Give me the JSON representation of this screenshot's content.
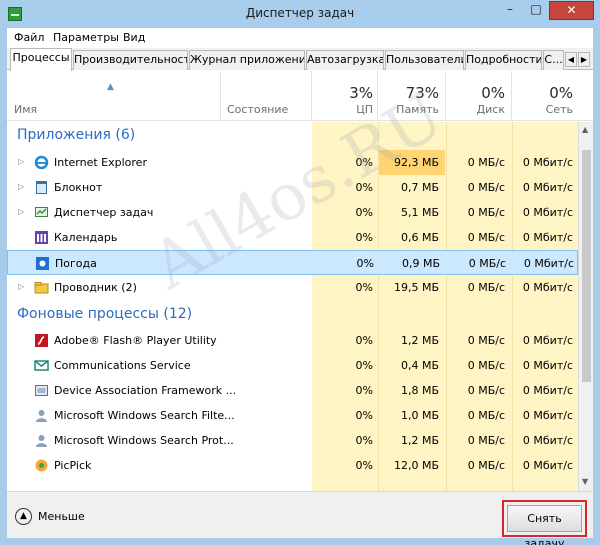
{
  "window": {
    "title": "Диспетчер задач",
    "minimize_glyph": "–",
    "maximize_glyph": "□",
    "close_glyph": "✕"
  },
  "menu": [
    "Файл",
    "Параметры",
    "Вид"
  ],
  "tabs": [
    "Процессы",
    "Производительность",
    "Журнал приложений",
    "Автозагрузка",
    "Пользователи",
    "Подробности",
    "С..."
  ],
  "columns": {
    "name": "Имя",
    "status": "Состояние",
    "cpu": {
      "percent": "3%",
      "label": "ЦП"
    },
    "memory": {
      "percent": "73%",
      "label": "Память"
    },
    "disk": {
      "percent": "0%",
      "label": "Диск"
    },
    "network": {
      "percent": "0%",
      "label": "Сеть"
    }
  },
  "groups": {
    "apps": {
      "title": "Приложения (6)",
      "rows": [
        {
          "name": "Internet Explorer",
          "icon": "ie-icon",
          "cpu": "0%",
          "mem": "92,3 МБ",
          "disk": "0 МБ/с",
          "net": "0 Мбит/с"
        },
        {
          "name": "Блокнот",
          "icon": "notepad-icon",
          "cpu": "0%",
          "mem": "0,7 МБ",
          "disk": "0 МБ/с",
          "net": "0 Мбит/с"
        },
        {
          "name": "Диспетчер задач",
          "icon": "task-manager-icon",
          "cpu": "0%",
          "mem": "5,1 МБ",
          "disk": "0 МБ/с",
          "net": "0 Мбит/с"
        },
        {
          "name": "Календарь",
          "icon": "calendar-icon",
          "cpu": "0%",
          "mem": "0,6 МБ",
          "disk": "0 МБ/с",
          "net": "0 Мбит/с"
        },
        {
          "name": "Погода",
          "icon": "weather-icon",
          "cpu": "0%",
          "mem": "0,9 МБ",
          "disk": "0 МБ/с",
          "net": "0 Мбит/с"
        },
        {
          "name": "Проводник (2)",
          "icon": "explorer-icon",
          "cpu": "0%",
          "mem": "19,5 МБ",
          "disk": "0 МБ/с",
          "net": "0 Мбит/с"
        }
      ]
    },
    "background": {
      "title": "Фоновые процессы (12)",
      "rows": [
        {
          "name": "Adobe® Flash® Player Utility",
          "icon": "flash-icon",
          "cpu": "0%",
          "mem": "1,2 МБ",
          "disk": "0 МБ/с",
          "net": "0 Мбит/с"
        },
        {
          "name": "Communications Service",
          "icon": "mail-icon",
          "cpu": "0%",
          "mem": "0,4 МБ",
          "disk": "0 МБ/с",
          "net": "0 Мбит/с"
        },
        {
          "name": "Device Association Framework ...",
          "icon": "device-icon",
          "cpu": "0%",
          "mem": "1,8 МБ",
          "disk": "0 МБ/с",
          "net": "0 Мбит/с"
        },
        {
          "name": "Microsoft Windows Search Filte...",
          "icon": "search-user-icon",
          "cpu": "0%",
          "mem": "1,0 МБ",
          "disk": "0 МБ/с",
          "net": "0 Мбит/с"
        },
        {
          "name": "Microsoft Windows Search Prot...",
          "icon": "search-user-icon",
          "cpu": "0%",
          "mem": "1,2 МБ",
          "disk": "0 МБ/с",
          "net": "0 Мбит/с"
        },
        {
          "name": "PicPick",
          "icon": "picpick-icon",
          "cpu": "0%",
          "mem": "12,0 МБ",
          "disk": "0 МБ/с",
          "net": "0 Мбит/с"
        }
      ]
    }
  },
  "selected_row": "Погода",
  "footer": {
    "fewer_label": "Меньше",
    "end_task_label": "Снять задачу"
  },
  "watermark": "All4os.RU",
  "colors": {
    "title_bar": "#a9cdec",
    "group_heading": "#2a6cc3",
    "heat_cell": "#fff4c4",
    "heat_cell_hot": "#ffd472",
    "selection": "#cce8ff",
    "highlight_frame": "#d6262a"
  }
}
